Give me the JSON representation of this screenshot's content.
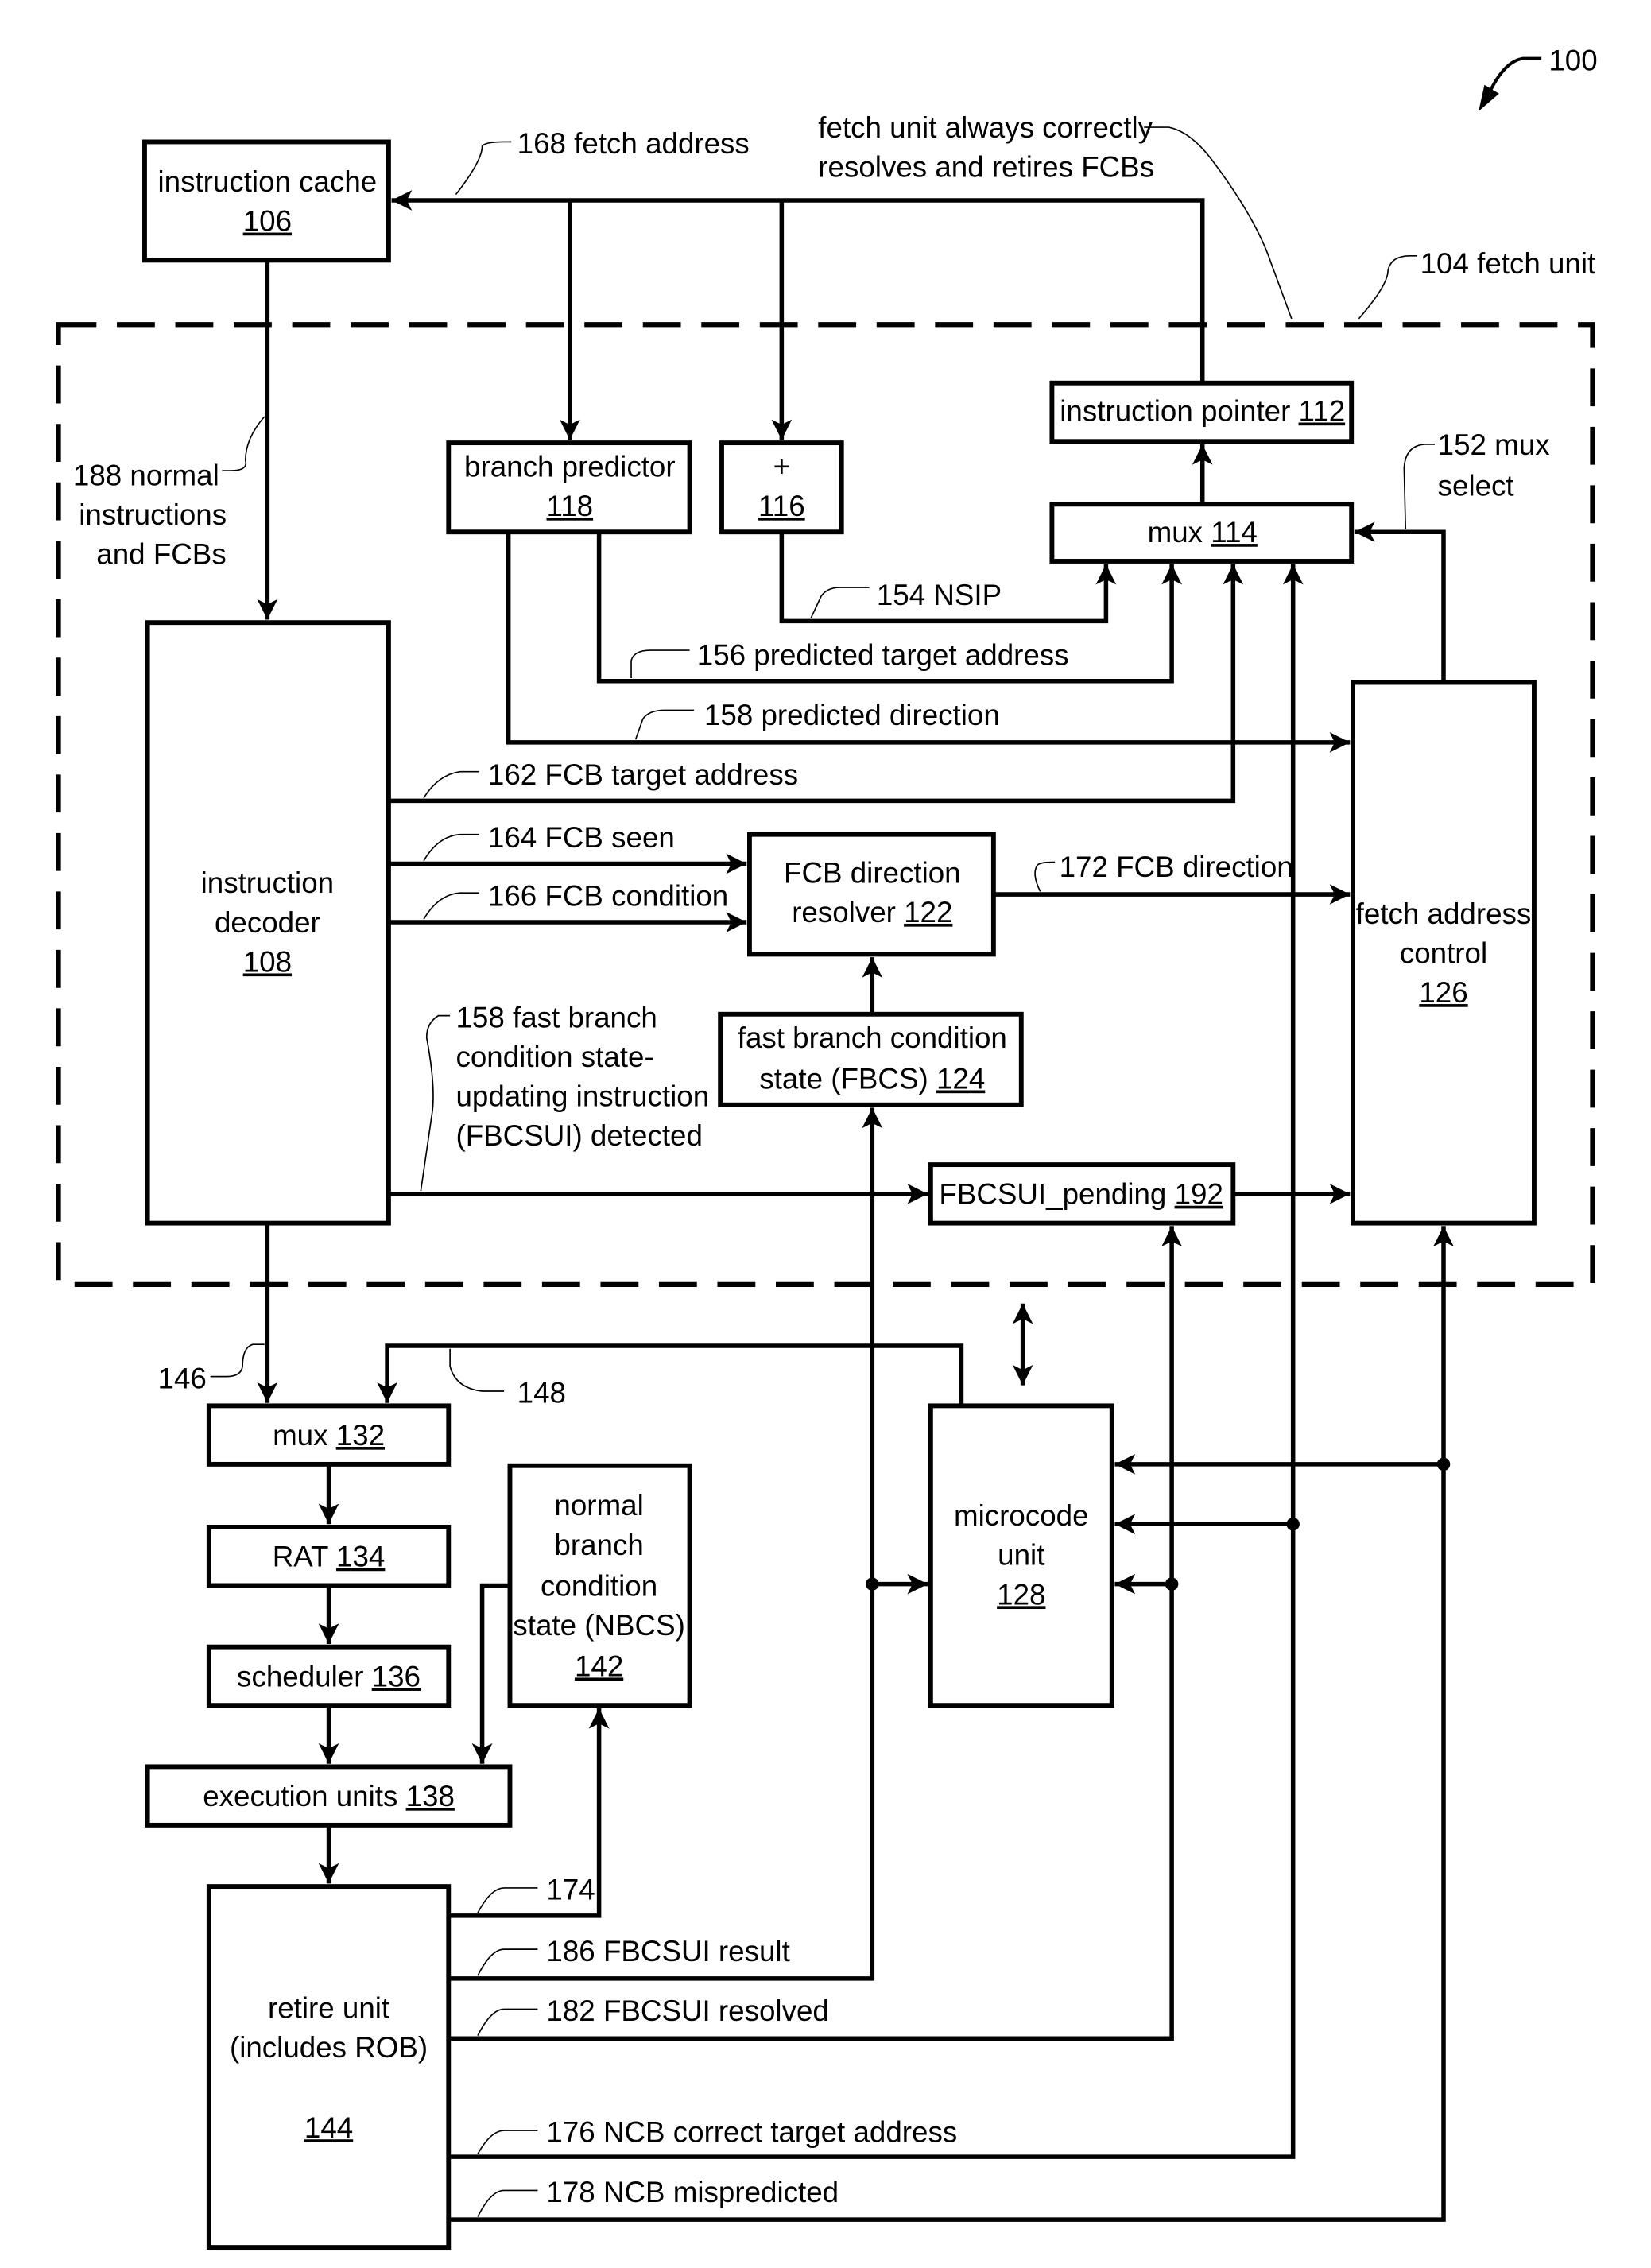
{
  "figure": {
    "number": "100",
    "fetch_unit_label": "104 fetch unit",
    "note_line1": "fetch unit always correctly",
    "note_line2": "resolves and retires FCBs"
  },
  "blocks": {
    "instruction_cache": {
      "name": "instruction cache",
      "ref": "106"
    },
    "instruction_decoder": {
      "line1": "instruction",
      "line2": "decoder",
      "ref": "108"
    },
    "instruction_pointer": {
      "name": "instruction pointer ",
      "ref": "112"
    },
    "mux_114": {
      "name": "mux ",
      "ref": "114"
    },
    "adder": {
      "name": "+",
      "ref": "116"
    },
    "branch_predictor": {
      "name": "branch predictor",
      "ref": "118"
    },
    "fcb_direction_resolver": {
      "line1": "FCB direction",
      "line2": "resolver  ",
      "ref": "122"
    },
    "fbcs": {
      "line1": "fast branch condition",
      "line2": "state (FBCS) ",
      "ref": "124"
    },
    "fetch_address_control": {
      "line1": "fetch address",
      "line2": "control",
      "ref": "126"
    },
    "fbcsui_pending": {
      "name": "FBCSUI_pending  ",
      "ref": "192"
    },
    "microcode_unit": {
      "line1": "microcode",
      "line2": "unit",
      "ref": "128"
    },
    "mux_132": {
      "name": "mux ",
      "ref": "132"
    },
    "rat": {
      "name": "RAT ",
      "ref": "134"
    },
    "scheduler": {
      "name": "scheduler ",
      "ref": "136"
    },
    "nbcs": {
      "line1": "normal",
      "line2": "branch",
      "line3": "condition",
      "line4": "state (NBCS)",
      "ref": "142"
    },
    "execution_units": {
      "name": "execution units  ",
      "ref": "138"
    },
    "retire_unit": {
      "line1": "retire unit",
      "line2": "(includes ROB)",
      "ref": "144"
    }
  },
  "signals": {
    "s168": "168 fetch address",
    "s188_1": "188  normal",
    "s188_2": "instructions",
    "s188_3": "and FCBs",
    "s152_1": "152 mux",
    "s152_2": "select",
    "s154": "154 NSIP",
    "s156": "156 predicted target address",
    "s158": "158 predicted direction",
    "s162": "162 FCB target address",
    "s164": "164 FCB seen",
    "s166": "166 FCB condition",
    "s172": "172 FCB direction",
    "s158b_1": "158 fast branch",
    "s158b_2": "condition state-",
    "s158b_3": "updating instruction",
    "s158b_4": "(FBCSUI) detected",
    "s146": "146",
    "s148": "148",
    "s174": "174",
    "s186": "186 FBCSUI result",
    "s182": "182 FBCSUI resolved",
    "s176": "176 NCB correct target address",
    "s178": "178 NCB mispredicted"
  }
}
